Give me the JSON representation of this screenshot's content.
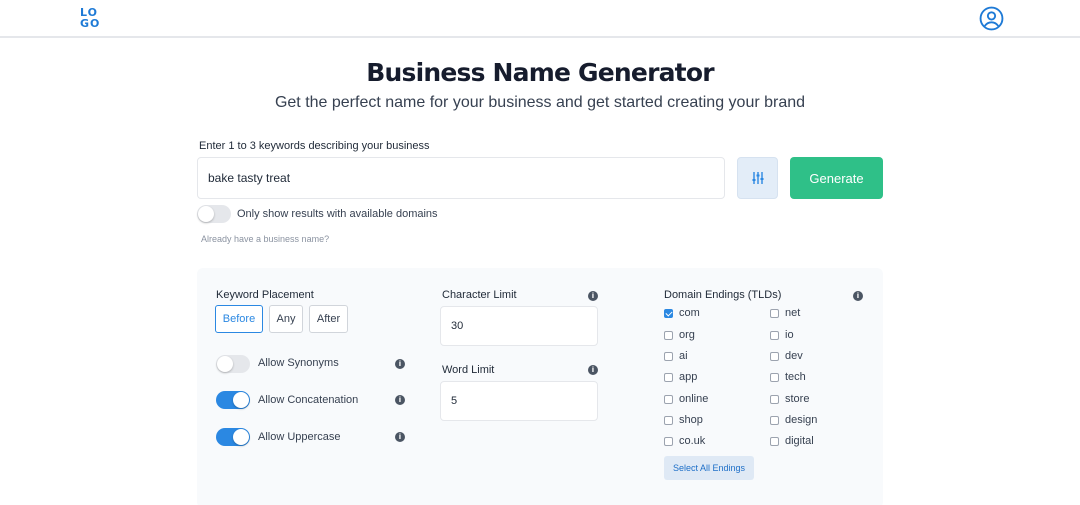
{
  "header": {
    "logo_line1": "LO",
    "logo_line2": "GO",
    "account_icon": "user-circle-icon"
  },
  "hero": {
    "title": "Business Name Generator",
    "subtitle": "Get the perfect name for your business and get started creating your brand"
  },
  "search": {
    "label": "Enter 1 to 3 keywords describing your business",
    "value": "bake tasty treat",
    "filter_icon": "sliders-icon",
    "generate_label": "Generate"
  },
  "availability": {
    "label": "Only show results with available domains",
    "enabled": false
  },
  "already_link": "Already have a business name?",
  "options": {
    "keyword_placement": {
      "label": "Keyword Placement",
      "choices": [
        "Before",
        "Any",
        "After"
      ],
      "selected": "Before"
    },
    "toggles": [
      {
        "label": "Allow Synonyms",
        "enabled": false
      },
      {
        "label": "Allow Concatenation",
        "enabled": true
      },
      {
        "label": "Allow Uppercase",
        "enabled": true
      }
    ],
    "character_limit": {
      "label": "Character Limit",
      "value": "30"
    },
    "word_limit": {
      "label": "Word Limit",
      "value": "5"
    },
    "domain_endings": {
      "label": "Domain Endings (TLDs)",
      "items": [
        {
          "name": "com",
          "checked": true
        },
        {
          "name": "net",
          "checked": false
        },
        {
          "name": "org",
          "checked": false
        },
        {
          "name": "io",
          "checked": false
        },
        {
          "name": "ai",
          "checked": false
        },
        {
          "name": "dev",
          "checked": false
        },
        {
          "name": "app",
          "checked": false
        },
        {
          "name": "tech",
          "checked": false
        },
        {
          "name": "online",
          "checked": false
        },
        {
          "name": "store",
          "checked": false
        },
        {
          "name": "shop",
          "checked": false
        },
        {
          "name": "design",
          "checked": false
        },
        {
          "name": "co.uk",
          "checked": false
        },
        {
          "name": "digital",
          "checked": false
        }
      ],
      "select_all_label": "Select All Endings"
    }
  },
  "colors": {
    "accent": "#2b88e2",
    "generate": "#2fc088",
    "logo": "#1e7ad6"
  }
}
